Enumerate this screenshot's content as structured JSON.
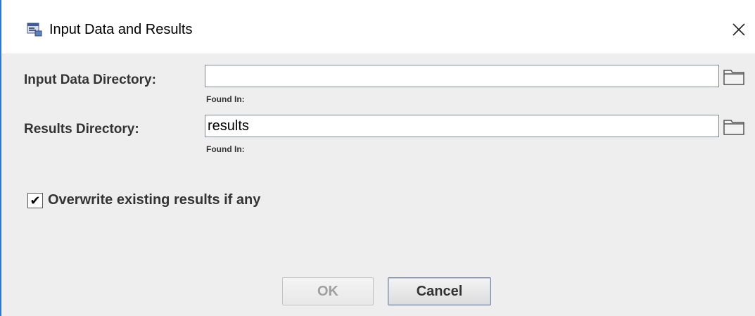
{
  "window": {
    "title": "Input Data and Results",
    "close_glyph": "✕",
    "icon": "app-window-icon"
  },
  "form": {
    "input_dir": {
      "label": "Input Data Directory:",
      "value": "",
      "found_in": "Found In:",
      "browse_icon": "folder-icon"
    },
    "results_dir": {
      "label": "Results Directory:",
      "value": "results",
      "found_in": "Found In:",
      "browse_icon": "folder-icon"
    },
    "overwrite": {
      "checked": true,
      "check_glyph": "✔",
      "label": "Overwrite existing results if any"
    }
  },
  "buttons": {
    "ok_label": "OK",
    "ok_enabled": false,
    "cancel_label": "Cancel"
  },
  "colors": {
    "window_border": "#2b79d7",
    "background": "#eeeeee"
  }
}
